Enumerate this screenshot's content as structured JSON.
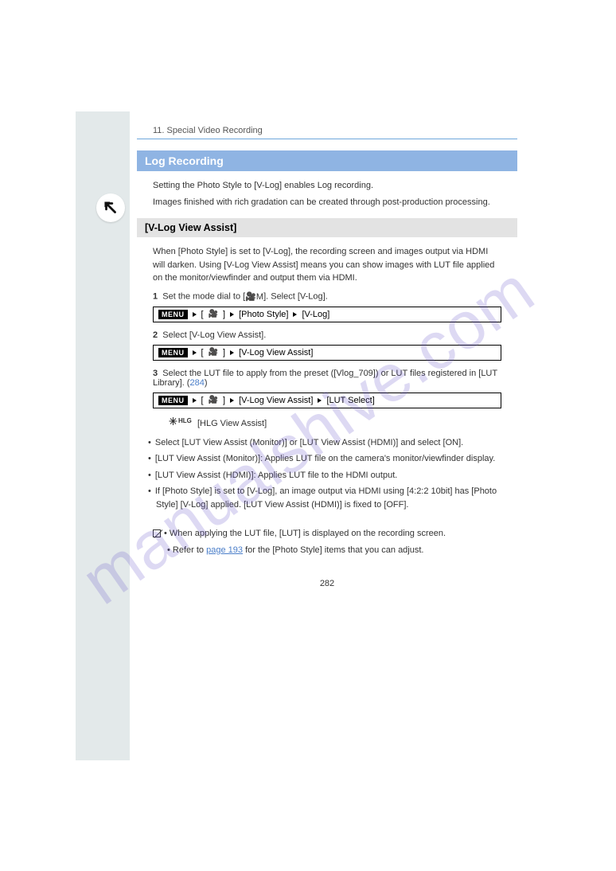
{
  "watermark": "manualshive.com",
  "breadcrumb": "11. Special Video Recording",
  "section_title": "Log Recording",
  "intro": {
    "p1": "Setting the Photo Style to [V-Log] enables Log recording.",
    "p2": "Images finished with rich gradation can be created through post-production processing."
  },
  "sub_title": "[V-Log View Assist]",
  "sub_p1": "When [Photo Style] is set to [V-Log], the recording screen and images output via HDMI will darken. Using [V-Log View Assist] means you can show images with LUT file applied on the monitor/viewfinder and output them via HDMI.",
  "steps": {
    "s1_a": "Set the mode dial to [",
    "s1_b": "]. Select [V-Log].",
    "menu1": {
      "segments": [
        "[",
        "]",
        "[Photo Style]",
        "[V-Log]"
      ]
    },
    "s2": "Select [V-Log View Assist].",
    "menu2": {
      "segments": [
        "[",
        "]",
        "[V-Log View Assist]"
      ]
    },
    "s3_a": "Select the LUT file to apply from the preset ([Vlog_709]) or LUT files registered in [LUT Library]. (",
    "s3_b": ")",
    "s3_link": "284",
    "menu3": {
      "segments": [
        "[",
        "]",
        "[V-Log View Assist]",
        "[LUT Select]"
      ]
    }
  },
  "hlg_line": "[HLG View Assist]",
  "bullets": {
    "b1": "Select [LUT View Assist (Monitor)] or [LUT View Assist (HDMI)] and select [ON].",
    "b2": "[LUT View Assist (Monitor)]: Applies LUT file on the camera's monitor/viewfinder display.",
    "b3": "[LUT View Assist (HDMI)]: Applies LUT file to the HDMI output.",
    "b4": "If [Photo Style] is set to [V-Log], an image output via HDMI using [4:2:2 10bit] has [Photo Style] [V-Log] applied. [LUT View Assist (HDMI)] is fixed to [OFF]."
  },
  "notes": {
    "n1": "When applying the LUT file, [LUT] is displayed on the recording screen.",
    "n2_a": "Refer to",
    "n2_link": "page 193",
    "n2_b": "for the [Photo Style] items that you can adjust."
  },
  "page_number": "282"
}
